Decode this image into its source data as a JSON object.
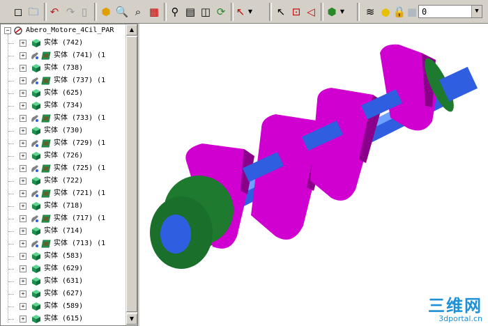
{
  "toolbar": {
    "icons": [
      "new-icon",
      "open-icon",
      "undo-icon",
      "redo-icon",
      "disabled-icon",
      "box-icon",
      "zoom-icon",
      "zoom-select-icon",
      "grid-icon",
      "search-icon",
      "table-icon",
      "frame-icon",
      "refresh-icon",
      "help-arrow-icon",
      "select-arrow-icon",
      "select-point-icon",
      "select-edge-icon",
      "render-cube-icon",
      "layer-stack-icon",
      "lightbulb-icon",
      "lock-icon",
      "color-square-icon"
    ],
    "layer_value": "0"
  },
  "tree": {
    "root_label": "Abero_Motore_4Cil_PAR",
    "items": [
      {
        "label": "实体 (742)",
        "type": "solid"
      },
      {
        "label": "实体 (741) (1",
        "type": "linked"
      },
      {
        "label": "实体 (738)",
        "type": "solid"
      },
      {
        "label": "实体 (737) (1",
        "type": "linked"
      },
      {
        "label": "实体 (625)",
        "type": "solid"
      },
      {
        "label": "实体 (734)",
        "type": "solid"
      },
      {
        "label": "实体 (733) (1",
        "type": "linked"
      },
      {
        "label": "实体 (730)",
        "type": "solid"
      },
      {
        "label": "实体 (729) (1",
        "type": "linked"
      },
      {
        "label": "实体 (726)",
        "type": "solid"
      },
      {
        "label": "实体 (725) (1",
        "type": "linked"
      },
      {
        "label": "实体 (722)",
        "type": "solid"
      },
      {
        "label": "实体 (721) (1",
        "type": "linked"
      },
      {
        "label": "实体 (718)",
        "type": "solid"
      },
      {
        "label": "实体 (717) (1",
        "type": "linked"
      },
      {
        "label": "实体 (714)",
        "type": "solid"
      },
      {
        "label": "实体 (713) (1",
        "type": "linked"
      },
      {
        "label": "实体 (583)",
        "type": "solid"
      },
      {
        "label": "实体 (629)",
        "type": "solid"
      },
      {
        "label": "实体 (631)",
        "type": "solid"
      },
      {
        "label": "实体 (627)",
        "type": "solid"
      },
      {
        "label": "实体 (589)",
        "type": "solid"
      },
      {
        "label": "实体 (615)",
        "type": "solid"
      }
    ]
  },
  "viewport": {
    "watermark_title": "三维网",
    "watermark_url": "3dportal.cn"
  },
  "colors": {
    "solid_cube": "#1f8f4f",
    "crank_web": "#d000d0",
    "journal": "#2f5fe0",
    "gear": "#1e7a2e"
  }
}
